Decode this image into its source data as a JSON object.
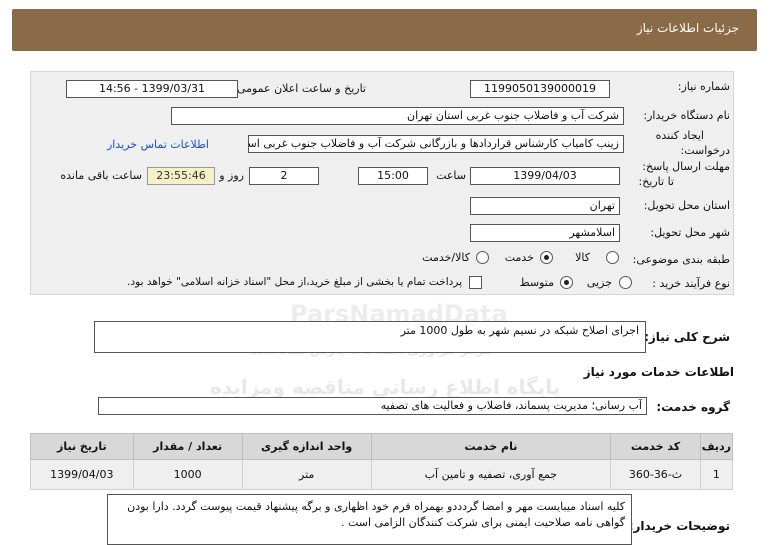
{
  "header": {
    "title": "جزئیات اطلاعات نیاز"
  },
  "form": {
    "need_number_label": "شماره نیاز:",
    "need_number_value": "1199050139000019",
    "announce_label": "تاریخ و ساعت اعلان عمومی:",
    "announce_value": "1399/03/31 - 14:56",
    "buyer_label": "نام دستگاه خریدار:",
    "buyer_value": "شرکت آب و فاضلاب جنوب غربی استان تهران",
    "creator_label_1": "ایجاد کننده",
    "creator_label_2": "درخواست:",
    "creator_value": "زینب کامیاب کارشناس قراردادها و بازرگانی شرکت آب و فاضلاب جنوب غربی استان تهران",
    "contact_link": "اطلاعات تماس خریدار",
    "deadline_label_1": "مهلت ارسال پاسخ:",
    "deadline_label_2": "تا تاریخ:",
    "deadline_date": "1399/04/03",
    "time_label": "ساعت",
    "deadline_time": "15:00",
    "days_value": "2",
    "days_label": "روز و",
    "remaining_time": "23:55:46",
    "remaining_label": "ساعت باقی مانده",
    "province_label": "استان محل تحویل:",
    "province_value": "تهران",
    "city_label": "شهر محل تحویل:",
    "city_value": "اسلامشهر",
    "category_label": "طبقه بندی موضوعی:",
    "category_options": [
      "کالا",
      "خدمت",
      "کالا/خدمت"
    ],
    "category_selected": "خدمت",
    "process_label": "نوع فرآیند خرید :",
    "process_options": [
      "جزیی",
      "متوسط"
    ],
    "process_selected": "متوسط",
    "payment_note": "پرداخت تمام یا بخشی از مبلغ خرید،از محل \"اسناد خزانه اسلامی\" خواهد بود."
  },
  "summary": {
    "label": "شرح کلی نیاز:",
    "value": "اجرای اصلاح شبکه در نسیم شهر به طول 1000 متر"
  },
  "services_section": {
    "title": "اطلاعات خدمات مورد نیاز"
  },
  "service_group": {
    "label": "گروه خدمت:",
    "value": "آب رسانی؛ مدیریت پسماند، فاضلاب و فعالیت های تصفیه"
  },
  "table": {
    "headers": [
      "ردیف",
      "کد خدمت",
      "نام خدمت",
      "واحد اندازه گیری",
      "تعداد / مقدار",
      "تاریخ نیاز"
    ],
    "rows": [
      [
        "1",
        "ث-36-360",
        "جمع آوری، تصفیه و تامین آب",
        "متر",
        "1000",
        "1399/04/03"
      ]
    ]
  },
  "buyer_notes": {
    "label": "توضیحات خریدار:",
    "value": "کلیه اسناد میبایست مهر و امضا گردددو بهمراه فرم خود اظهاری و برگه پیشنهاد قیمت پیوست گردد. دارا بودن گواهی نامه صلاحیت ایمنی برای شرکت کنندگان الزامی است ."
  },
  "watermark": {
    "line1": "ParsNamadData",
    "line2": "مرکز فراوری اطلاعات پارس نماد داده",
    "line3": "پایگاه اطلاع رسانی مناقصه ومزایده",
    "line4": "۰۲۱-۸۸۳۴۹۶۷۰-۵"
  },
  "colors": {
    "header_bg": "#8a6a47",
    "panel_bg": "#efefef",
    "link": "#1a4fd0",
    "timer_bg": "#f5f0c8"
  }
}
